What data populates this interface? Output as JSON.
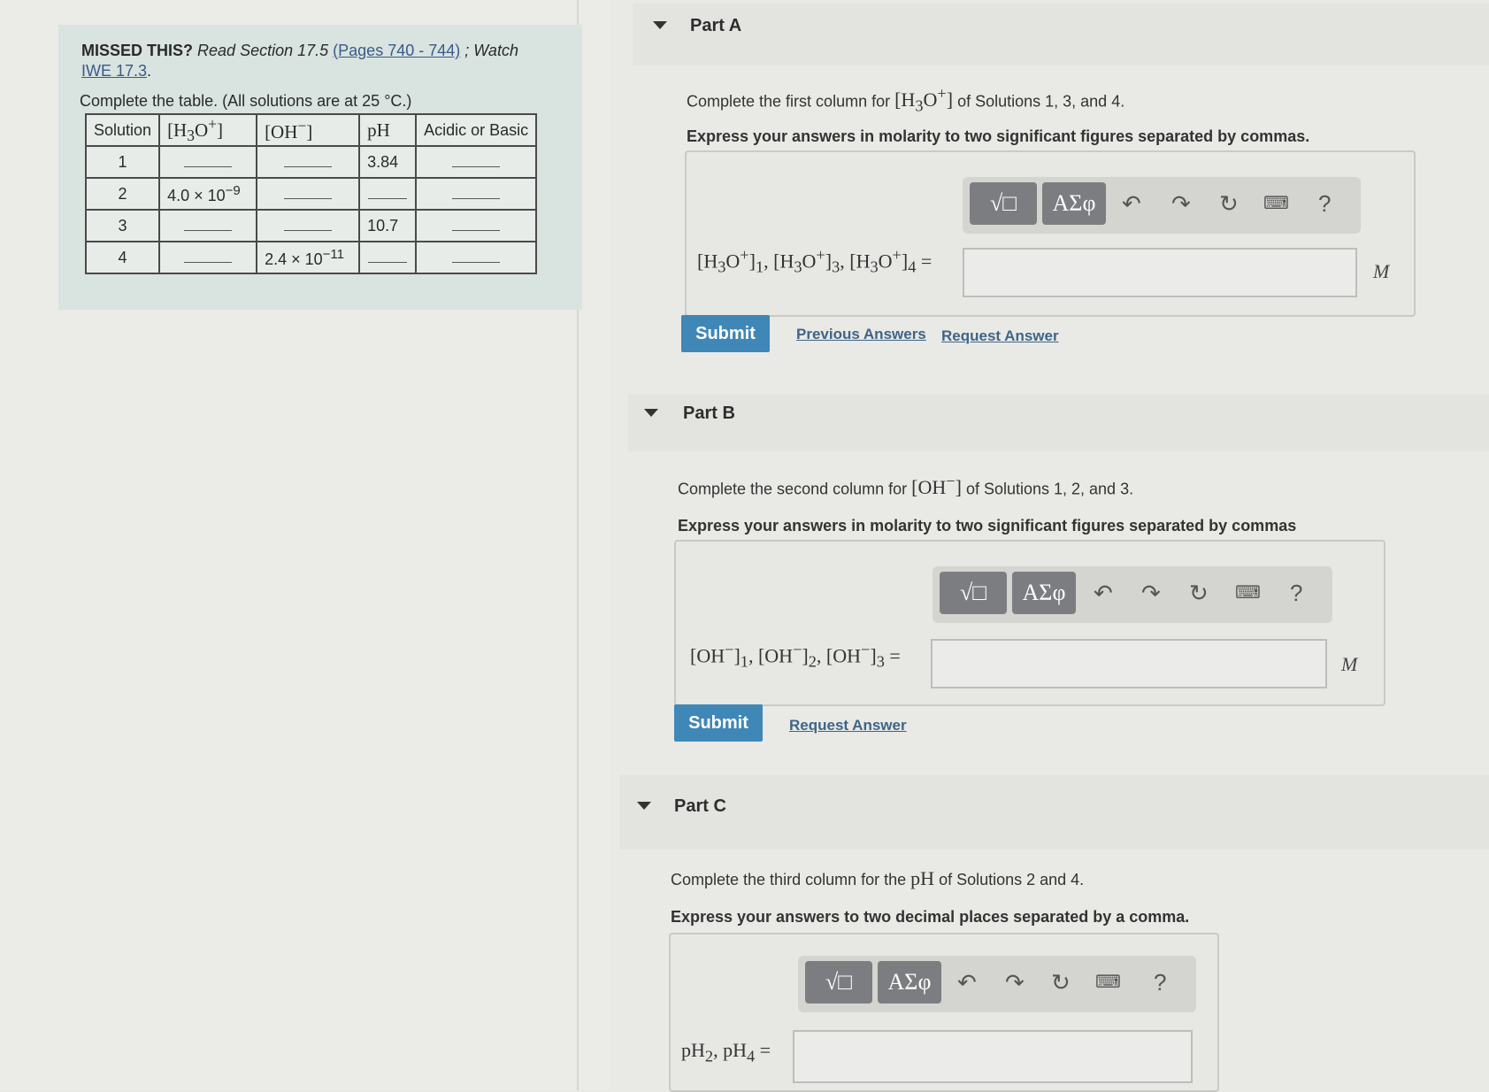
{
  "missed": {
    "label": "MISSED THIS?",
    "read_text": "Read Section 17.5",
    "pages_link": "(Pages 740 - 744)",
    "watch_text": "; Watch",
    "iwe_link": "IWE 17.3",
    "period": "."
  },
  "table_note": "Complete the table. (All solutions are at 25 °C.)",
  "table": {
    "headers": [
      "Solution",
      "[H3O+]",
      "[OH−]",
      "pH",
      "Acidic or Basic"
    ],
    "rows": [
      [
        "1",
        "",
        "",
        "3.84",
        ""
      ],
      [
        "2",
        "4.0 × 10−9",
        "",
        "",
        ""
      ],
      [
        "3",
        "",
        "",
        "10.7",
        ""
      ],
      [
        "4",
        "",
        "2.4 × 10−11",
        "",
        ""
      ]
    ]
  },
  "toolbar": {
    "templates_label": "√□",
    "symbols_label": "ΑΣφ",
    "undo_icon": "undo-icon",
    "redo_icon": "redo-icon",
    "reset_icon": "reset-icon",
    "keyboard_icon": "keyboard-icon",
    "help_label": "?"
  },
  "partA": {
    "title": "Part A",
    "prompt_pre": "Complete the first column for",
    "prompt_math": "[H3O+]",
    "prompt_post": "of Solutions 1, 3, and 4.",
    "instruction": "Express your answers in molarity to two significant figures separated by commas.",
    "eq_label": "[H3O+]1, [H3O+]3, [H3O+]4 =",
    "unit": "M",
    "submit": "Submit",
    "prev_answers": "Previous Answers",
    "request_answer": "Request Answer"
  },
  "partB": {
    "title": "Part B",
    "prompt_pre": "Complete the second column for",
    "prompt_math": "[OH−]",
    "prompt_post": "of Solutions 1, 2, and 3.",
    "instruction": "Express your answers in molarity to two significant figures separated by commas",
    "eq_label": "[OH−]1, [OH−]2, [OH−]3 =",
    "unit": "M",
    "submit": "Submit",
    "request_answer": "Request Answer"
  },
  "partC": {
    "title": "Part C",
    "prompt_pre": "Complete the third column for the",
    "prompt_math": "pH",
    "prompt_post": "of Solutions 2 and 4.",
    "instruction": "Express your answers to two decimal places separated by a comma.",
    "eq_label": "pH2, pH4 ="
  }
}
